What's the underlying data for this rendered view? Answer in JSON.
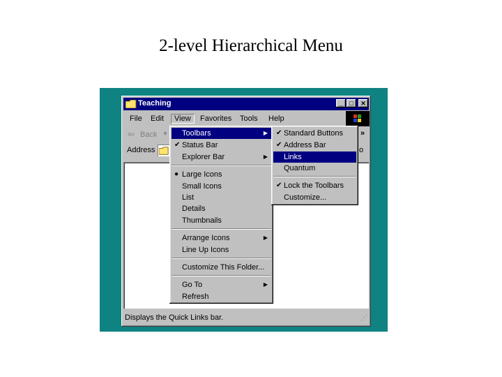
{
  "slide": {
    "title": "2-level Hierarchical Menu"
  },
  "window": {
    "title": "Teaching"
  },
  "menubar": [
    "File",
    "Edit",
    "View",
    "Favorites",
    "Tools",
    "Help"
  ],
  "toolbar": {
    "back_label": "Back",
    "more_label": "»"
  },
  "address": {
    "label": "Address",
    "go_label": "o"
  },
  "view_menu": {
    "toolbars": "Toolbars",
    "status_bar": "Status Bar",
    "explorer_bar": "Explorer Bar",
    "large_icons": "Large Icons",
    "small_icons": "Small Icons",
    "list": "List",
    "details": "Details",
    "thumbnails": "Thumbnails",
    "arrange_icons": "Arrange Icons",
    "line_up_icons": "Line Up Icons",
    "customize_folder": "Customize This Folder...",
    "go_to": "Go To",
    "refresh": "Refresh"
  },
  "toolbars_submenu": {
    "standard_buttons": "Standard Buttons",
    "address_bar": "Address Bar",
    "links": "Links",
    "quantum": "Quantum",
    "lock_toolbars": "Lock the Toolbars",
    "customize": "Customize..."
  },
  "status": {
    "text": "Displays the Quick Links bar."
  },
  "colors": {
    "desktop": "#0f8282",
    "titlebar": "#000080",
    "highlight": "#000080",
    "face": "#c0c0c0"
  }
}
